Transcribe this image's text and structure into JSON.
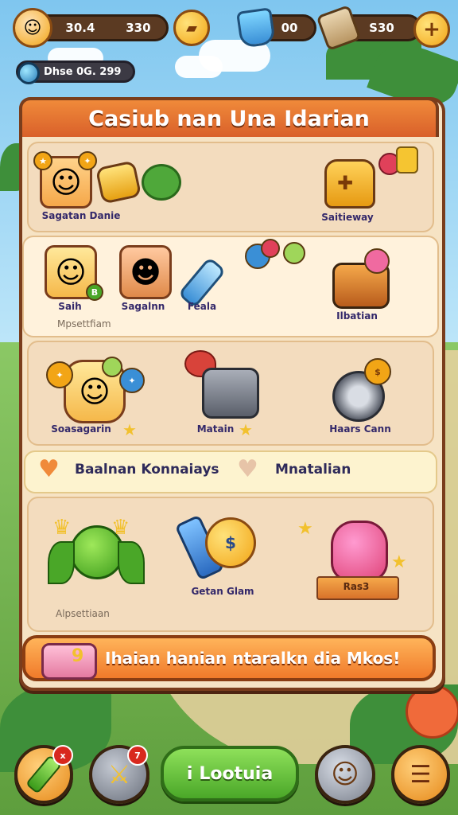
{
  "hud": {
    "player_avatar": "player-avatar",
    "stat_primary": "30.4",
    "stat_secondary": "330",
    "currency_gems": "00",
    "currency_gold": "S30",
    "level_text": "Dhse 0G. 299"
  },
  "panel": {
    "title": "Casiub nan Una Idarian"
  },
  "row1": {
    "items": [
      {
        "label": "Sagatan Danie",
        "icon": "hero-portrait-icon"
      },
      {
        "label": "Saitieway",
        "icon": "backpack-icon"
      }
    ]
  },
  "row2": {
    "items": [
      {
        "label": "Saih",
        "icon": "hero-portrait-icon"
      },
      {
        "label": "Sagalnn",
        "icon": "hero-portrait-icon"
      },
      {
        "label": "Feala",
        "icon": "crystal-icon"
      },
      {
        "label": "Ilbatian",
        "icon": "chest-icon"
      }
    ],
    "sublabel": "Mpsettfiam"
  },
  "row3": {
    "items": [
      {
        "label": "Soasagarin",
        "icon": "hero-portrait-icon"
      },
      {
        "label": "Matain",
        "icon": "anvil-icon"
      },
      {
        "label": "Haars Cann",
        "icon": "shield-icon"
      }
    ]
  },
  "banner": {
    "text_left": "Baalnan Konnaiays",
    "text_right": "Mnatalian"
  },
  "row4": {
    "items": [
      {
        "label": "",
        "icon": "green-monster-icon"
      },
      {
        "label": "Getan Glam",
        "icon": "coin-trophy-icon"
      },
      {
        "label": "Ras3",
        "icon": "pink-creature-icon"
      }
    ],
    "sublabel": "Alpsettiaan"
  },
  "cta": {
    "badge": "9",
    "text": "Ihaian hanian ntaralkn dia Mkos!"
  },
  "nav": {
    "badge_left": "x",
    "badge_center_left": "7",
    "play_label": "Lootuia"
  },
  "colors": {
    "accent": "#f08a3a",
    "panel_border": "#7a3d1c",
    "play_green": "#4aa728"
  }
}
